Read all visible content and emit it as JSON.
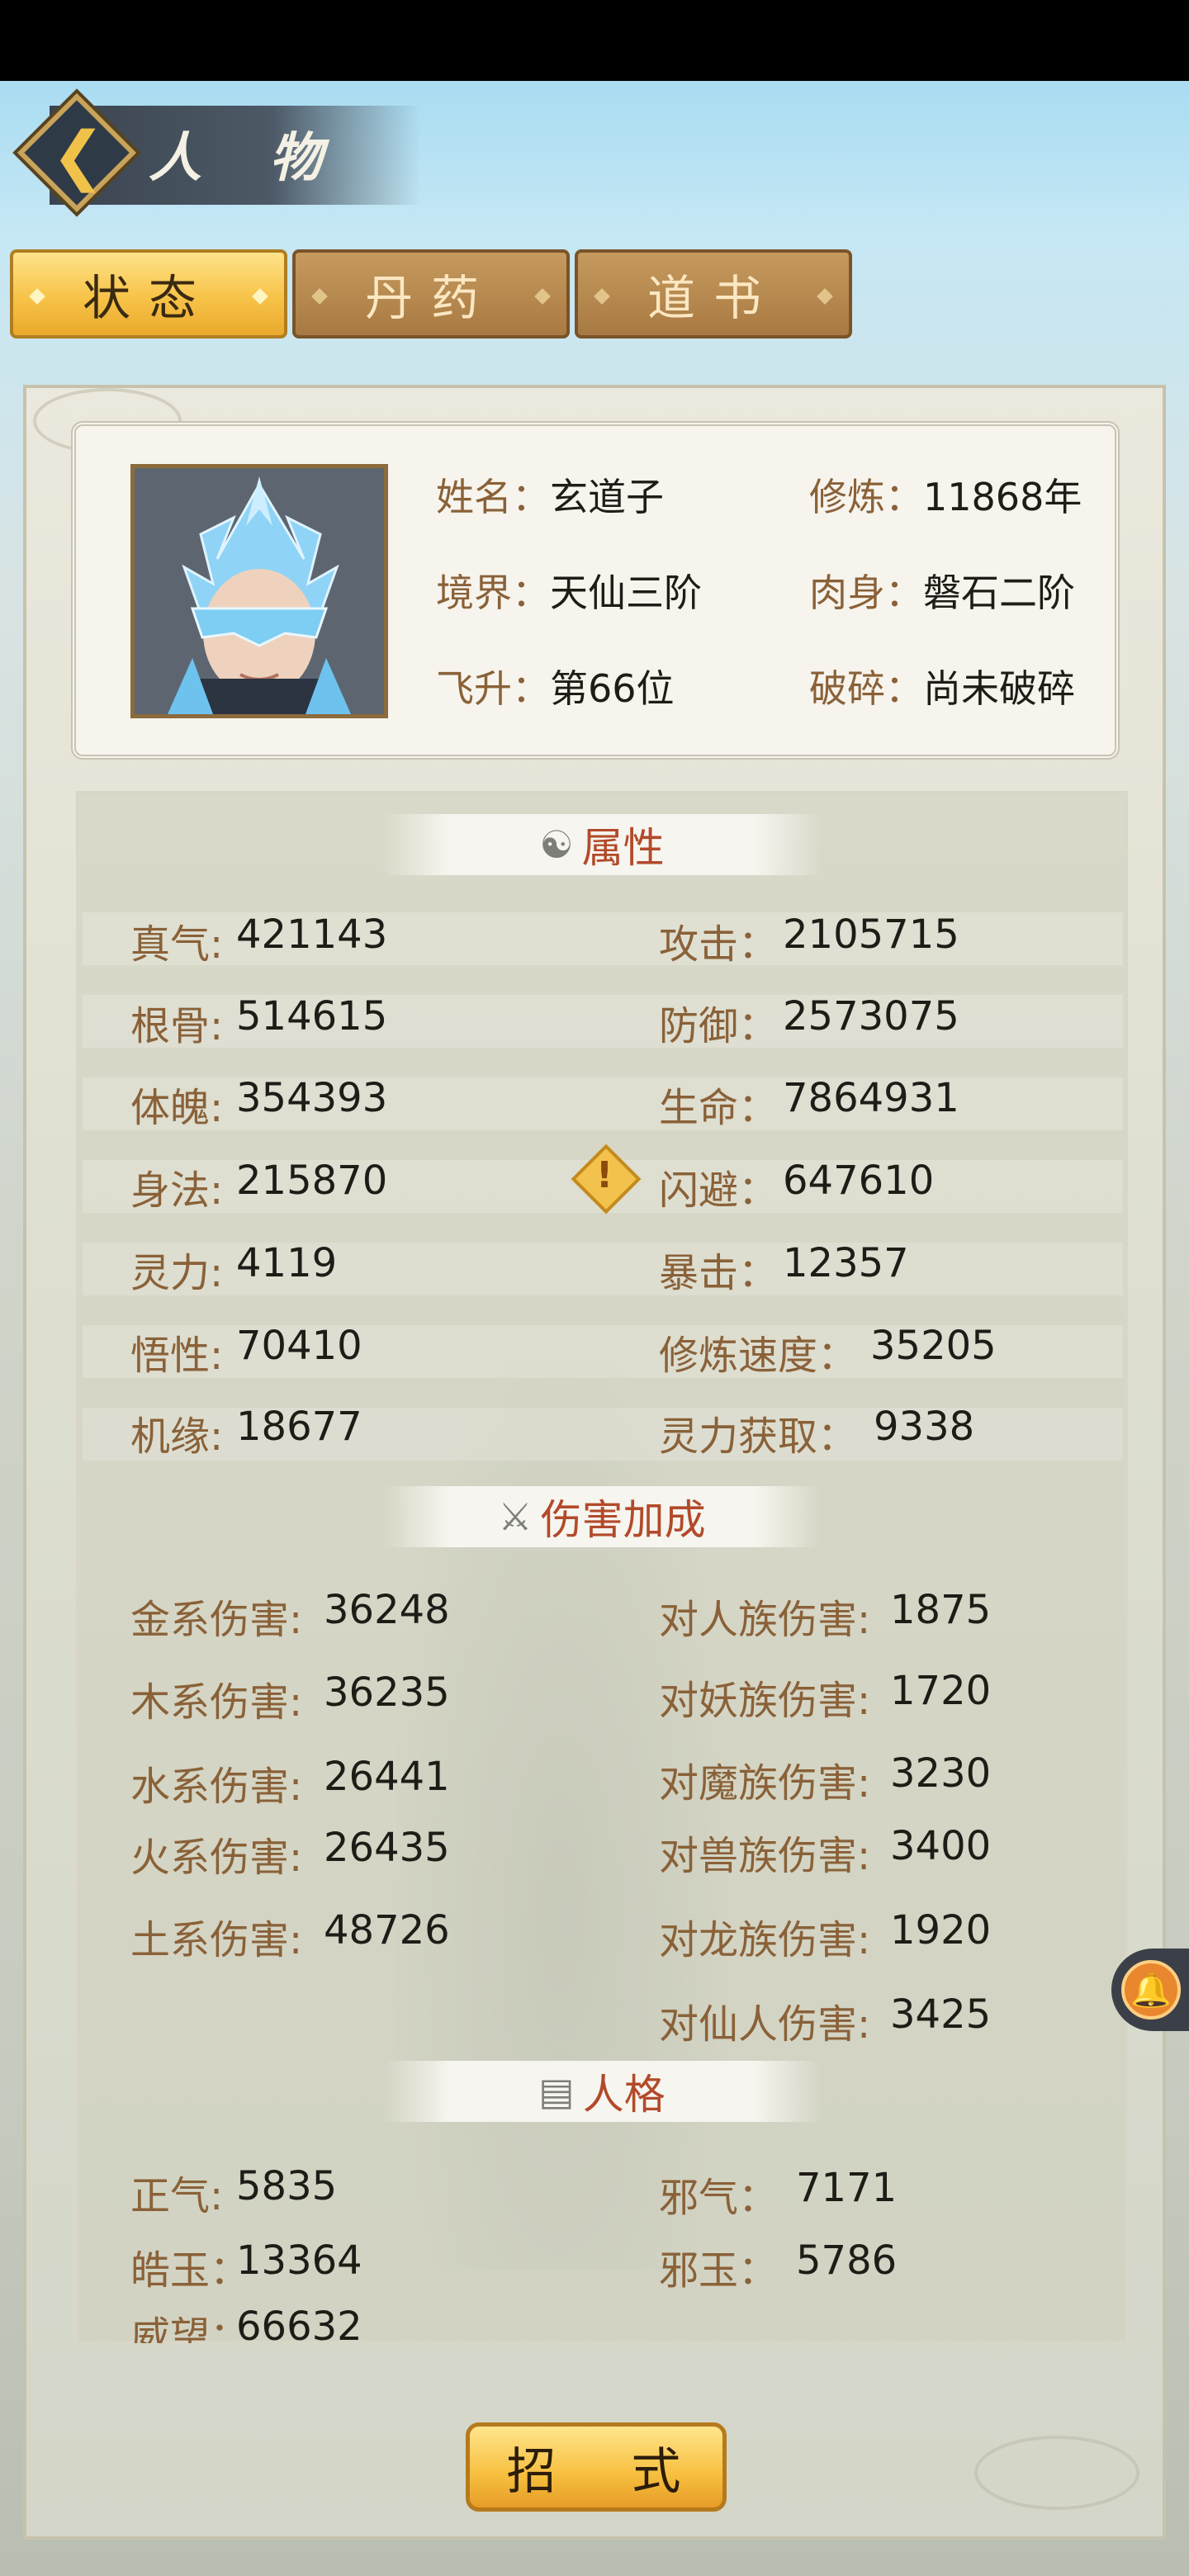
{
  "header": {
    "title": "人 物"
  },
  "tabs": [
    {
      "label": "状态",
      "active": true
    },
    {
      "label": "丹药",
      "active": false
    },
    {
      "label": "道书",
      "active": false
    }
  ],
  "profile": {
    "name_label": "姓名",
    "name_value": "玄道子",
    "cultivation_label": "修炼",
    "cultivation_value": "11868年",
    "realm_label": "境界",
    "realm_value": "天仙三阶",
    "body_label": "肉身",
    "body_value": "磐石二阶",
    "ascend_label": "飞升",
    "ascend_value": "第66位",
    "break_label": "破碎",
    "break_value": "尚未破碎"
  },
  "attributes": {
    "title": "属性",
    "left": [
      {
        "label": "真气",
        "value": "421143"
      },
      {
        "label": "根骨",
        "value": "514615"
      },
      {
        "label": "体魄",
        "value": "354393"
      },
      {
        "label": "身法",
        "value": "215870"
      },
      {
        "label": "灵力",
        "value": "4119"
      },
      {
        "label": "悟性",
        "value": "70410"
      },
      {
        "label": "机缘",
        "value": "18677"
      }
    ],
    "right": [
      {
        "label": "攻击",
        "value": "2105715"
      },
      {
        "label": "防御",
        "value": "2573075"
      },
      {
        "label": "生命",
        "value": "7864931"
      },
      {
        "label": "闪避",
        "value": "647610"
      },
      {
        "label": "暴击",
        "value": "12357"
      },
      {
        "label": "修炼速度",
        "value": "35205"
      },
      {
        "label": "灵力获取",
        "value": "9338"
      }
    ]
  },
  "damage": {
    "title": "伤害加成",
    "left": [
      {
        "label": "金系伤害",
        "value": "36248"
      },
      {
        "label": "木系伤害",
        "value": "36235"
      },
      {
        "label": "水系伤害",
        "value": "26441"
      },
      {
        "label": "火系伤害",
        "value": "26435"
      },
      {
        "label": "土系伤害",
        "value": "48726"
      }
    ],
    "right": [
      {
        "label": "对人族伤害",
        "value": "1875"
      },
      {
        "label": "对妖族伤害",
        "value": "1720"
      },
      {
        "label": "对魔族伤害",
        "value": "3230"
      },
      {
        "label": "对兽族伤害",
        "value": "3400"
      },
      {
        "label": "对龙族伤害",
        "value": "1920"
      },
      {
        "label": "对仙人伤害",
        "value": "3425"
      }
    ]
  },
  "personality": {
    "title": "人格",
    "left": [
      {
        "label": "正气",
        "value": "5835"
      },
      {
        "label": "皓玉",
        "value": "13364"
      },
      {
        "label": "威望",
        "value": "66632"
      }
    ],
    "right": [
      {
        "label": "邪气",
        "value": "7171"
      },
      {
        "label": "邪玉",
        "value": "5786"
      }
    ]
  },
  "bottom_button": "招 式",
  "colon": "："
}
